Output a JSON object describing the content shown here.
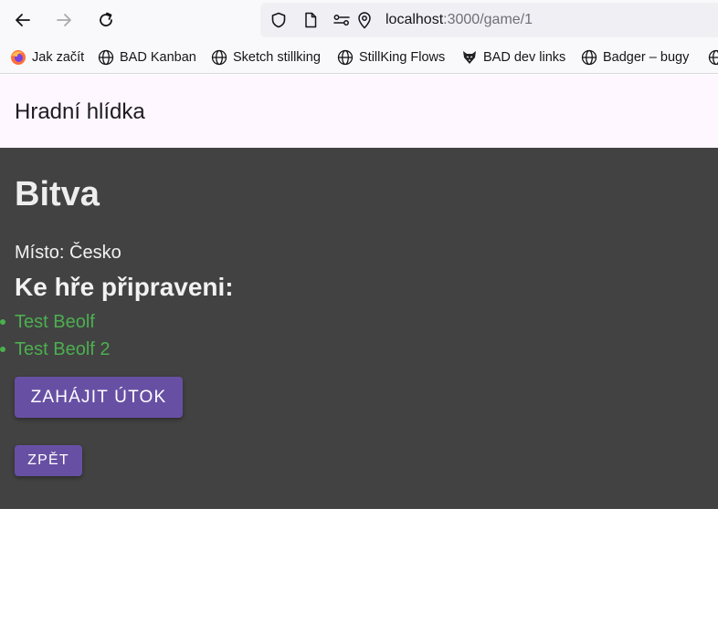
{
  "browser": {
    "url_host": "localhost",
    "url_rest": ":3000/game/1",
    "icons": {
      "back": "back-arrow-icon",
      "forward": "forward-arrow-icon",
      "reload": "reload-icon",
      "shield": "shield-icon",
      "page": "page-icon",
      "permissions": "permissions-icon",
      "location": "location-pin-icon"
    },
    "bookmarks": [
      {
        "label": "Jak začít",
        "icon": "firefox-icon"
      },
      {
        "label": "BAD Kanban",
        "icon": "globe-icon"
      },
      {
        "label": "Sketch stillking",
        "icon": "globe-icon"
      },
      {
        "label": "StillKing Flows",
        "icon": "globe-icon"
      },
      {
        "label": "BAD dev links",
        "icon": "wolf-icon"
      },
      {
        "label": "Badger – bugy",
        "icon": "globe-icon"
      },
      {
        "label": "",
        "icon": "globe-icon"
      }
    ]
  },
  "app": {
    "title": "Hradní hlídka"
  },
  "battle": {
    "title": "Bitva",
    "location": "Místo: Česko",
    "ready_heading": "Ke hře připraveni:",
    "players": [
      "Test Beolf",
      "Test Beolf 2"
    ],
    "attack_button": "Zahájit útok",
    "back_button": "Zpět"
  },
  "colors": {
    "panel_background": "#424242",
    "header_background": "#fef7ff",
    "button": "#6750a4",
    "player_text": "#4caf50"
  }
}
